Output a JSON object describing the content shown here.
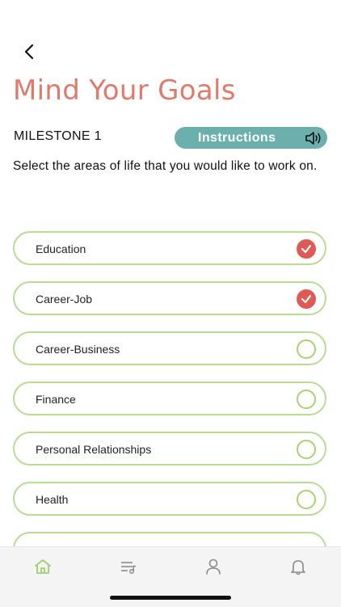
{
  "header": {
    "back_icon": "chevron-left-icon",
    "title": "Mind Your Goals",
    "milestone": "MILESTONE 1",
    "instructions_label": "Instructions",
    "speaker_icon": "speaker-icon"
  },
  "prompt": "Select the areas of life that you would like to work on.",
  "areas": [
    {
      "label": "Education",
      "selected": true
    },
    {
      "label": "Career-Job",
      "selected": true
    },
    {
      "label": "Career-Business",
      "selected": false
    },
    {
      "label": "Finance",
      "selected": false
    },
    {
      "label": "Personal Relationships",
      "selected": false
    },
    {
      "label": "Health",
      "selected": false
    }
  ],
  "tabbar": {
    "items": [
      {
        "icon": "home-icon",
        "active": true
      },
      {
        "icon": "playlist-icon",
        "active": false
      },
      {
        "icon": "profile-icon",
        "active": false
      },
      {
        "icon": "bell-icon",
        "active": false
      }
    ]
  },
  "colors": {
    "title": "#e07a6b",
    "instructions_bg": "#6bb0ad",
    "item_border": "#b9dc94",
    "check_on": "#e05a55",
    "check_off_border": "#a7d46e",
    "active_tab": "#9ccf6f"
  }
}
